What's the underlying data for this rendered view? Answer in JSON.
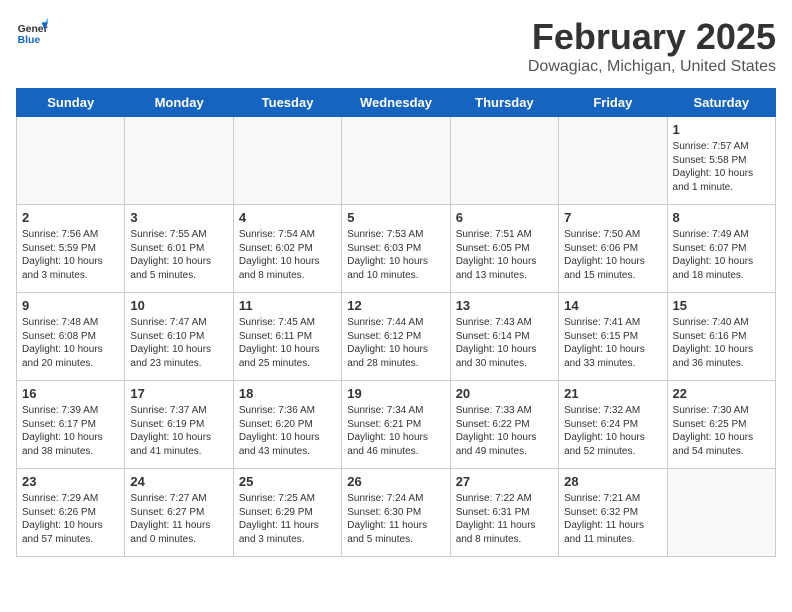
{
  "header": {
    "logo_line1": "General",
    "logo_line2": "Blue",
    "month": "February 2025",
    "location": "Dowagiac, Michigan, United States"
  },
  "days_of_week": [
    "Sunday",
    "Monday",
    "Tuesday",
    "Wednesday",
    "Thursday",
    "Friday",
    "Saturday"
  ],
  "weeks": [
    [
      {
        "day": "",
        "empty": true
      },
      {
        "day": "",
        "empty": true
      },
      {
        "day": "",
        "empty": true
      },
      {
        "day": "",
        "empty": true
      },
      {
        "day": "",
        "empty": true
      },
      {
        "day": "",
        "empty": true
      },
      {
        "day": "1",
        "sunrise": "Sunrise: 7:57 AM",
        "sunset": "Sunset: 5:58 PM",
        "daylight": "Daylight: 10 hours and 1 minute."
      }
    ],
    [
      {
        "day": "2",
        "sunrise": "Sunrise: 7:56 AM",
        "sunset": "Sunset: 5:59 PM",
        "daylight": "Daylight: 10 hours and 3 minutes."
      },
      {
        "day": "3",
        "sunrise": "Sunrise: 7:55 AM",
        "sunset": "Sunset: 6:01 PM",
        "daylight": "Daylight: 10 hours and 5 minutes."
      },
      {
        "day": "4",
        "sunrise": "Sunrise: 7:54 AM",
        "sunset": "Sunset: 6:02 PM",
        "daylight": "Daylight: 10 hours and 8 minutes."
      },
      {
        "day": "5",
        "sunrise": "Sunrise: 7:53 AM",
        "sunset": "Sunset: 6:03 PM",
        "daylight": "Daylight: 10 hours and 10 minutes."
      },
      {
        "day": "6",
        "sunrise": "Sunrise: 7:51 AM",
        "sunset": "Sunset: 6:05 PM",
        "daylight": "Daylight: 10 hours and 13 minutes."
      },
      {
        "day": "7",
        "sunrise": "Sunrise: 7:50 AM",
        "sunset": "Sunset: 6:06 PM",
        "daylight": "Daylight: 10 hours and 15 minutes."
      },
      {
        "day": "8",
        "sunrise": "Sunrise: 7:49 AM",
        "sunset": "Sunset: 6:07 PM",
        "daylight": "Daylight: 10 hours and 18 minutes."
      }
    ],
    [
      {
        "day": "9",
        "sunrise": "Sunrise: 7:48 AM",
        "sunset": "Sunset: 6:08 PM",
        "daylight": "Daylight: 10 hours and 20 minutes."
      },
      {
        "day": "10",
        "sunrise": "Sunrise: 7:47 AM",
        "sunset": "Sunset: 6:10 PM",
        "daylight": "Daylight: 10 hours and 23 minutes."
      },
      {
        "day": "11",
        "sunrise": "Sunrise: 7:45 AM",
        "sunset": "Sunset: 6:11 PM",
        "daylight": "Daylight: 10 hours and 25 minutes."
      },
      {
        "day": "12",
        "sunrise": "Sunrise: 7:44 AM",
        "sunset": "Sunset: 6:12 PM",
        "daylight": "Daylight: 10 hours and 28 minutes."
      },
      {
        "day": "13",
        "sunrise": "Sunrise: 7:43 AM",
        "sunset": "Sunset: 6:14 PM",
        "daylight": "Daylight: 10 hours and 30 minutes."
      },
      {
        "day": "14",
        "sunrise": "Sunrise: 7:41 AM",
        "sunset": "Sunset: 6:15 PM",
        "daylight": "Daylight: 10 hours and 33 minutes."
      },
      {
        "day": "15",
        "sunrise": "Sunrise: 7:40 AM",
        "sunset": "Sunset: 6:16 PM",
        "daylight": "Daylight: 10 hours and 36 minutes."
      }
    ],
    [
      {
        "day": "16",
        "sunrise": "Sunrise: 7:39 AM",
        "sunset": "Sunset: 6:17 PM",
        "daylight": "Daylight: 10 hours and 38 minutes."
      },
      {
        "day": "17",
        "sunrise": "Sunrise: 7:37 AM",
        "sunset": "Sunset: 6:19 PM",
        "daylight": "Daylight: 10 hours and 41 minutes."
      },
      {
        "day": "18",
        "sunrise": "Sunrise: 7:36 AM",
        "sunset": "Sunset: 6:20 PM",
        "daylight": "Daylight: 10 hours and 43 minutes."
      },
      {
        "day": "19",
        "sunrise": "Sunrise: 7:34 AM",
        "sunset": "Sunset: 6:21 PM",
        "daylight": "Daylight: 10 hours and 46 minutes."
      },
      {
        "day": "20",
        "sunrise": "Sunrise: 7:33 AM",
        "sunset": "Sunset: 6:22 PM",
        "daylight": "Daylight: 10 hours and 49 minutes."
      },
      {
        "day": "21",
        "sunrise": "Sunrise: 7:32 AM",
        "sunset": "Sunset: 6:24 PM",
        "daylight": "Daylight: 10 hours and 52 minutes."
      },
      {
        "day": "22",
        "sunrise": "Sunrise: 7:30 AM",
        "sunset": "Sunset: 6:25 PM",
        "daylight": "Daylight: 10 hours and 54 minutes."
      }
    ],
    [
      {
        "day": "23",
        "sunrise": "Sunrise: 7:29 AM",
        "sunset": "Sunset: 6:26 PM",
        "daylight": "Daylight: 10 hours and 57 minutes."
      },
      {
        "day": "24",
        "sunrise": "Sunrise: 7:27 AM",
        "sunset": "Sunset: 6:27 PM",
        "daylight": "Daylight: 11 hours and 0 minutes."
      },
      {
        "day": "25",
        "sunrise": "Sunrise: 7:25 AM",
        "sunset": "Sunset: 6:29 PM",
        "daylight": "Daylight: 11 hours and 3 minutes."
      },
      {
        "day": "26",
        "sunrise": "Sunrise: 7:24 AM",
        "sunset": "Sunset: 6:30 PM",
        "daylight": "Daylight: 11 hours and 5 minutes."
      },
      {
        "day": "27",
        "sunrise": "Sunrise: 7:22 AM",
        "sunset": "Sunset: 6:31 PM",
        "daylight": "Daylight: 11 hours and 8 minutes."
      },
      {
        "day": "28",
        "sunrise": "Sunrise: 7:21 AM",
        "sunset": "Sunset: 6:32 PM",
        "daylight": "Daylight: 11 hours and 11 minutes."
      },
      {
        "day": "",
        "empty": true
      }
    ]
  ]
}
